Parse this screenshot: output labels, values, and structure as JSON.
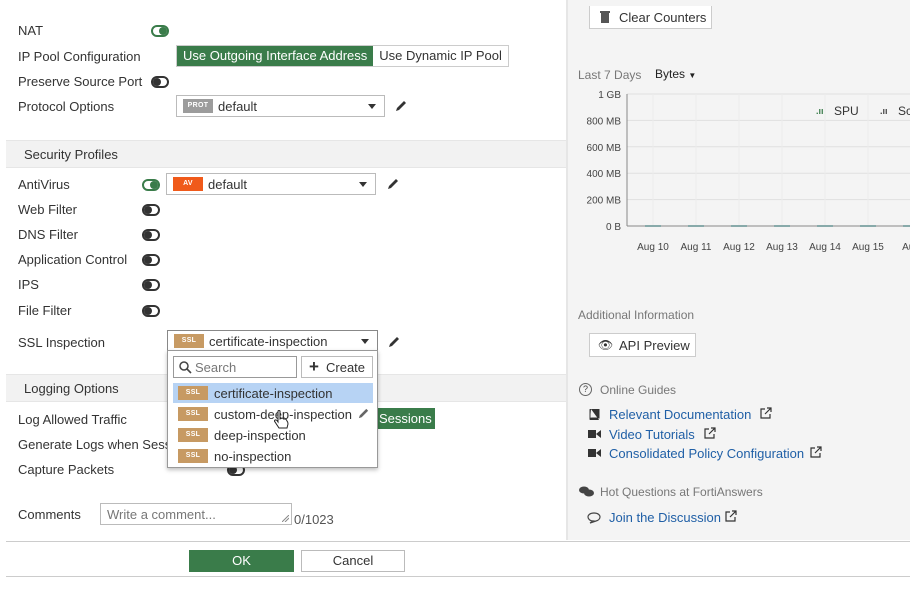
{
  "form": {
    "nat_label": "NAT",
    "ip_pool_label": "IP Pool Configuration",
    "ip_pool_options": [
      "Use Outgoing Interface Address",
      "Use Dynamic IP Pool"
    ],
    "preserve_label": "Preserve Source Port",
    "protocol_label": "Protocol Options",
    "protocol_badge": "PROT",
    "protocol_value": "default"
  },
  "security": {
    "header": "Security Profiles",
    "antivirus_label": "AntiVirus",
    "av_badge": "AV",
    "av_value": "default",
    "web_filter": "Web Filter",
    "dns_filter": "DNS Filter",
    "app_control": "Application Control",
    "ips": "IPS",
    "file_filter": "File Filter",
    "ssl_label": "SSL Inspection",
    "ssl_badge": "SSL",
    "ssl_value": "certificate-inspection"
  },
  "dropdown": {
    "search_placeholder": "Search",
    "create_label": "Create",
    "items": [
      "certificate-inspection",
      "custom-deep-inspection",
      "deep-inspection",
      "no-inspection"
    ]
  },
  "logging": {
    "header": "Logging Options",
    "allowed_traffic": "Log Allowed Traffic",
    "sessions": "Sessions",
    "generate_logs": "Generate Logs when Sess",
    "capture": "Capture Packets"
  },
  "comments": {
    "label": "Comments",
    "placeholder": "Write a comment...",
    "count": "0/1023"
  },
  "footer": {
    "ok": "OK",
    "cancel": "Cancel"
  },
  "right": {
    "clear_counters": "Clear Counters",
    "period": "Last 7 Days",
    "unit": "Bytes",
    "legend": [
      "SPU",
      "Sc"
    ],
    "additional_info": "Additional Information",
    "api_preview": "API Preview",
    "online_guides": "Online Guides",
    "relevant_docs": "Relevant Documentation",
    "video_tutorials": "Video Tutorials",
    "consolidated": "Consolidated Policy Configuration",
    "hot_questions": "Hot Questions at FortiAnswers",
    "join": "Join the Discussion"
  },
  "chart_data": {
    "type": "line",
    "title": "",
    "xlabel": "",
    "ylabel": "",
    "categories": [
      "Aug 10",
      "Aug 11",
      "Aug 12",
      "Aug 13",
      "Aug 14",
      "Aug 15",
      "Aug"
    ],
    "y_ticks": [
      "1 GB",
      "800 MB",
      "600 MB",
      "400 MB",
      "200 MB",
      "0 B"
    ],
    "y_values": [
      1000,
      800,
      600,
      400,
      200,
      0
    ],
    "ylim": [
      0,
      1000
    ],
    "grid": true,
    "series": [
      {
        "name": "SPU",
        "values": [
          0,
          0,
          0,
          0,
          0,
          0,
          0
        ]
      }
    ]
  }
}
